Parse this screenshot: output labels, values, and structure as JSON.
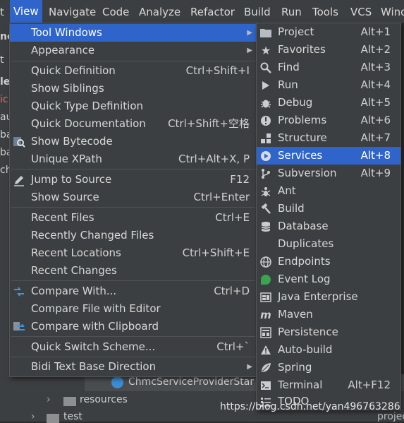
{
  "menubar": {
    "items": [
      "t",
      "View",
      "Navigate",
      "Code",
      "Analyze",
      "Refactor",
      "Build",
      "Run",
      "Tools",
      "VCS",
      "Windo"
    ]
  },
  "background": {
    "left_fragments": [
      "nc",
      "t",
      "le",
      "ic",
      "au",
      "ba",
      "ba",
      "ch"
    ],
    "tree": {
      "selected_file": "ChmcServiceProviderStar",
      "resources": "resources",
      "test": "test",
      "project_frag": "project"
    }
  },
  "view_menu": {
    "items": [
      {
        "label": "Tool Windows",
        "shortcut": "",
        "submenu": true,
        "selected": true
      },
      {
        "label": "Appearance",
        "shortcut": "",
        "submenu": true
      },
      {
        "label": "Quick Definition",
        "shortcut": "Ctrl+Shift+I"
      },
      {
        "label": "Show Siblings",
        "shortcut": ""
      },
      {
        "label": "Quick Type Definition",
        "shortcut": ""
      },
      {
        "label": "Quick Documentation",
        "shortcut": "Ctrl+Shift+空格"
      },
      {
        "label": "Show Bytecode",
        "shortcut": "",
        "icon": "search-bytecode-icon"
      },
      {
        "label": "Unique XPath",
        "shortcut": "Ctrl+Alt+X, P"
      },
      {
        "label": "Jump to Source",
        "shortcut": "F12",
        "icon": "pencil-icon"
      },
      {
        "label": "Show Source",
        "shortcut": "Ctrl+Enter"
      },
      {
        "label": "Recent Files",
        "shortcut": "Ctrl+E"
      },
      {
        "label": "Recently Changed Files",
        "shortcut": ""
      },
      {
        "label": "Recent Locations",
        "shortcut": "Ctrl+Shift+E"
      },
      {
        "label": "Recent Changes",
        "shortcut": ""
      },
      {
        "label": "Compare With...",
        "shortcut": "Ctrl+D",
        "icon": "compare-arrows-icon"
      },
      {
        "label": "Compare File with Editor",
        "shortcut": ""
      },
      {
        "label": "Compare with Clipboard",
        "shortcut": "",
        "icon": "compare-clipboard-icon"
      },
      {
        "label": "Quick Switch Scheme...",
        "shortcut": "Ctrl+`"
      },
      {
        "label": "Bidi Text Base Direction",
        "shortcut": "",
        "submenu": true
      }
    ]
  },
  "tool_windows_menu": {
    "items": [
      {
        "label": "Project",
        "shortcut": "Alt+1",
        "icon": "folder-icon"
      },
      {
        "label": "Favorites",
        "shortcut": "Alt+2",
        "icon": "star-icon"
      },
      {
        "label": "Find",
        "shortcut": "Alt+3",
        "icon": "search-icon"
      },
      {
        "label": "Run",
        "shortcut": "Alt+4",
        "icon": "play-icon"
      },
      {
        "label": "Debug",
        "shortcut": "Alt+5",
        "icon": "bug-icon"
      },
      {
        "label": "Problems",
        "shortcut": "Alt+6",
        "icon": "warning-circle-icon"
      },
      {
        "label": "Structure",
        "shortcut": "Alt+7",
        "icon": "structure-icon"
      },
      {
        "label": "Services",
        "shortcut": "Alt+8",
        "icon": "services-play-icon",
        "selected": true
      },
      {
        "label": "Subversion",
        "shortcut": "Alt+9",
        "icon": "subversion-icon"
      },
      {
        "label": "Ant",
        "shortcut": "",
        "icon": "ant-icon"
      },
      {
        "label": "Build",
        "shortcut": "",
        "icon": "hammer-icon"
      },
      {
        "label": "Database",
        "shortcut": "",
        "icon": "database-icon"
      },
      {
        "label": "Duplicates",
        "shortcut": ""
      },
      {
        "label": "Endpoints",
        "shortcut": "",
        "icon": "globe-icon"
      },
      {
        "label": "Event Log",
        "shortcut": "",
        "icon": "event-log-icon"
      },
      {
        "label": "Java Enterprise",
        "shortcut": "",
        "icon": "java-enterprise-icon"
      },
      {
        "label": "Maven",
        "shortcut": "",
        "icon": "maven-icon"
      },
      {
        "label": "Persistence",
        "shortcut": "",
        "icon": "persistence-icon"
      },
      {
        "label": "Auto-build",
        "shortcut": "",
        "icon": "warning-triangle-icon"
      },
      {
        "label": "Spring",
        "shortcut": "",
        "icon": "spring-leaf-icon"
      },
      {
        "label": "Terminal",
        "shortcut": "Alt+F12",
        "icon": "terminal-icon"
      },
      {
        "label": "TODO",
        "shortcut": "",
        "icon": "todo-icon"
      }
    ]
  },
  "watermark": "https://blog.csdn.net/yan496763286",
  "colors": {
    "selection": "#2f65ca",
    "menu_bg": "#3c3f41",
    "event_log_green": "#3ca350"
  }
}
